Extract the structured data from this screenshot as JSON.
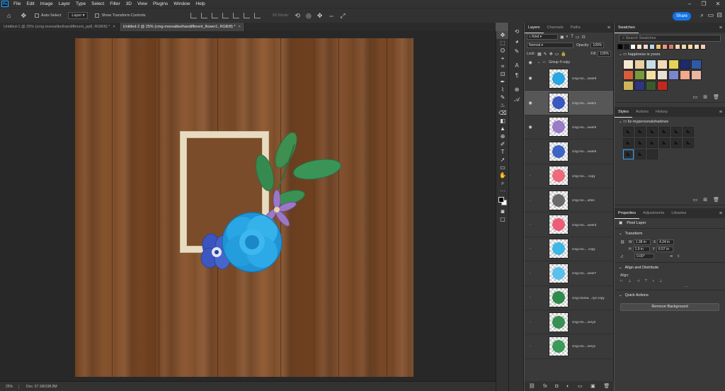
{
  "app": {
    "logo": "Ps"
  },
  "menu": [
    "File",
    "Edit",
    "Image",
    "Layer",
    "Type",
    "Select",
    "Filter",
    "3D",
    "View",
    "Plugins",
    "Window",
    "Help"
  ],
  "window_controls": [
    "–",
    "❐",
    "✕"
  ],
  "options": {
    "auto_select_label": "Auto-Select",
    "auto_select_target": "Layer",
    "show_transform_label": "Show Transform Controls",
    "mode_3d_label": "3D Mode:",
    "share_label": "Share"
  },
  "doc_tabs": [
    {
      "title": "Untitled-1 @ 25% (cmg-morealikethandifferent_pp8, RGB/8) *",
      "active": false
    },
    {
      "title": "Untitled-2 @ 25% (cmg-morealikethandifferent_flower1, RGB/8) *",
      "active": true
    }
  ],
  "status": {
    "zoom": "25%",
    "doc": "Doc: 37.1M/198.8M"
  },
  "tools": [
    "✥",
    "⬚",
    "ʘ",
    "⌖",
    "⌗",
    "⊡",
    "✒",
    "⌇",
    "✎",
    "♨",
    "⌫",
    "◧",
    "▲",
    "⊕",
    "✐",
    "T",
    "➚",
    "▭",
    "✋",
    "⌕",
    "···"
  ],
  "layers_panel": {
    "tabs": [
      "Layers",
      "Channels",
      "Paths"
    ],
    "kind_label": "Kind",
    "blend_mode": "Normal",
    "opacity_label": "Opacity:",
    "opacity_value": "100%",
    "lock_label": "Lock:",
    "fill_label": "Fill:",
    "fill_value": "100%",
    "group_name": "Group 4 copy",
    "layers": [
      {
        "name": "cmg-mo....ower8",
        "visible": true,
        "selected": false,
        "color": "#28a7e0"
      },
      {
        "name": "cmg-mo....ower1",
        "visible": true,
        "selected": true,
        "color": "#3b58c0"
      },
      {
        "name": "cmg-mo....ower5",
        "visible": true,
        "selected": false,
        "color": "#9a7cc8"
      },
      {
        "name": "cmg-mo....ower6",
        "visible": false,
        "selected": false,
        "color": "#3e64c4"
      },
      {
        "name": "cmg-mo.... copy",
        "visible": false,
        "selected": false,
        "color": "#ee6a7c"
      },
      {
        "name": "cmg-mo....utton",
        "visible": false,
        "selected": false,
        "color": "#6a6a6a"
      },
      {
        "name": "cmg-mo....ower3",
        "visible": false,
        "selected": false,
        "color": "#ee5d78"
      },
      {
        "name": "cmg-mo.... copy",
        "visible": false,
        "selected": false,
        "color": "#3fb6e6"
      },
      {
        "name": "cmg-mo....ower7",
        "visible": false,
        "selected": false,
        "color": "#5bc0ec"
      },
      {
        "name": "cmg-morea....ry2 copy",
        "visible": false,
        "selected": false,
        "color": "#2f8a4c"
      },
      {
        "name": "cmg-mo....nery2",
        "visible": false,
        "selected": false,
        "color": "#3a8f55"
      },
      {
        "name": "cmg-mo....nery1",
        "visible": false,
        "selected": false,
        "color": "#3c9a58"
      }
    ],
    "footer_icons": [
      "⛓",
      "fx",
      "◘",
      "◐",
      "▭",
      "▣",
      "🗑"
    ]
  },
  "swatches": {
    "title": "Swatches",
    "search_placeholder": "Search Swatches",
    "recent": [
      "#000000",
      "#1a1a1a",
      "#ffffff",
      "#fbe3cf",
      "#f3d8c7",
      "#b5d6e8",
      "#e8c36a",
      "#e89a7a",
      "#d87a6a",
      "#f1d3b8",
      "#f5d5a5",
      "#f4d9a8",
      "#eedec2",
      "#f7c9b0"
    ],
    "group_title": "happiness is yours",
    "group_colors": [
      "#f6e7d1",
      "#e9cfa3",
      "#c7dde4",
      "#f5d9b8",
      "#e6d45a",
      "#1e2a6e",
      "#2e5aa8",
      "#d85c3c",
      "#7a9a3a",
      "#f3e0a3",
      "#e8e0d2",
      "#7c86c8",
      "#f0a98a",
      "#eab6a0",
      "#cdb35a",
      "#2e3480",
      "#3a5a2e",
      "#c2291e"
    ]
  },
  "styles": {
    "tabs": [
      "Styles",
      "Actions",
      "History"
    ],
    "folder_name": "liz-mypersonalshadows"
  },
  "properties": {
    "tabs": [
      "Properties",
      "Adjustments",
      "Libraries"
    ],
    "layer_type": "Pixel Layer",
    "transform_title": "Transform",
    "w_label": "W",
    "w_value": "1.38 in",
    "h_label": "H",
    "h_value": "1.9 in",
    "x_label": "X",
    "x_value": "4.24 in",
    "y_label": "Y",
    "y_value": "6.57 in",
    "angle_value": "0.00°",
    "align_title": "Align and Distribute",
    "align_label": "Align:",
    "quick_actions_title": "Quick Actions",
    "remove_bg_label": "Remove Background"
  }
}
